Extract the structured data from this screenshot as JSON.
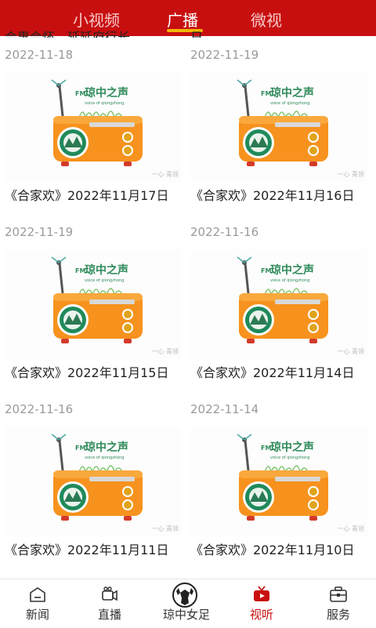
{
  "top_tabs": [
    {
      "label": "小视频"
    },
    {
      "label": "广播"
    },
    {
      "label": "微视"
    }
  ],
  "clipped_top": {
    "left_title": "会惠会怀，延延府行长...",
    "right_title": "日",
    "left_date": "2022-11-18",
    "right_date": "2022-11-19"
  },
  "cards": [
    {
      "title": "《合家欢》2022年11月17日",
      "date": "2022-11-19"
    },
    {
      "title": "《合家欢》2022年11月16日",
      "date": "2022-11-16"
    },
    {
      "title": "《合家欢》2022年11月15日",
      "date": "2022-11-16"
    },
    {
      "title": "《合家欢》2022年11月14日",
      "date": "2022-11-14"
    },
    {
      "title": "《合家欢》2022年11月11日",
      "date": ""
    },
    {
      "title": "《合家欢》2022年11月10日",
      "date": ""
    }
  ],
  "thumbnail": {
    "fm_label": "FM",
    "station_name": "琼中之声",
    "subtitle": "voice of qiongzhong",
    "watermark": "一心 青领"
  },
  "bottom_nav": [
    {
      "label": "新闻",
      "icon": "news-icon"
    },
    {
      "label": "直播",
      "icon": "live-camera-icon"
    },
    {
      "label": "琼中女足",
      "icon": "soccer-ball-icon"
    },
    {
      "label": "视听",
      "icon": "tv-icon"
    },
    {
      "label": "服务",
      "icon": "briefcase-icon"
    }
  ],
  "colors": {
    "brand_red": "#c80f10",
    "tab_indicator": "#f2b600",
    "radio_orange": "#f7921e",
    "radio_green": "#1f8a5b"
  }
}
